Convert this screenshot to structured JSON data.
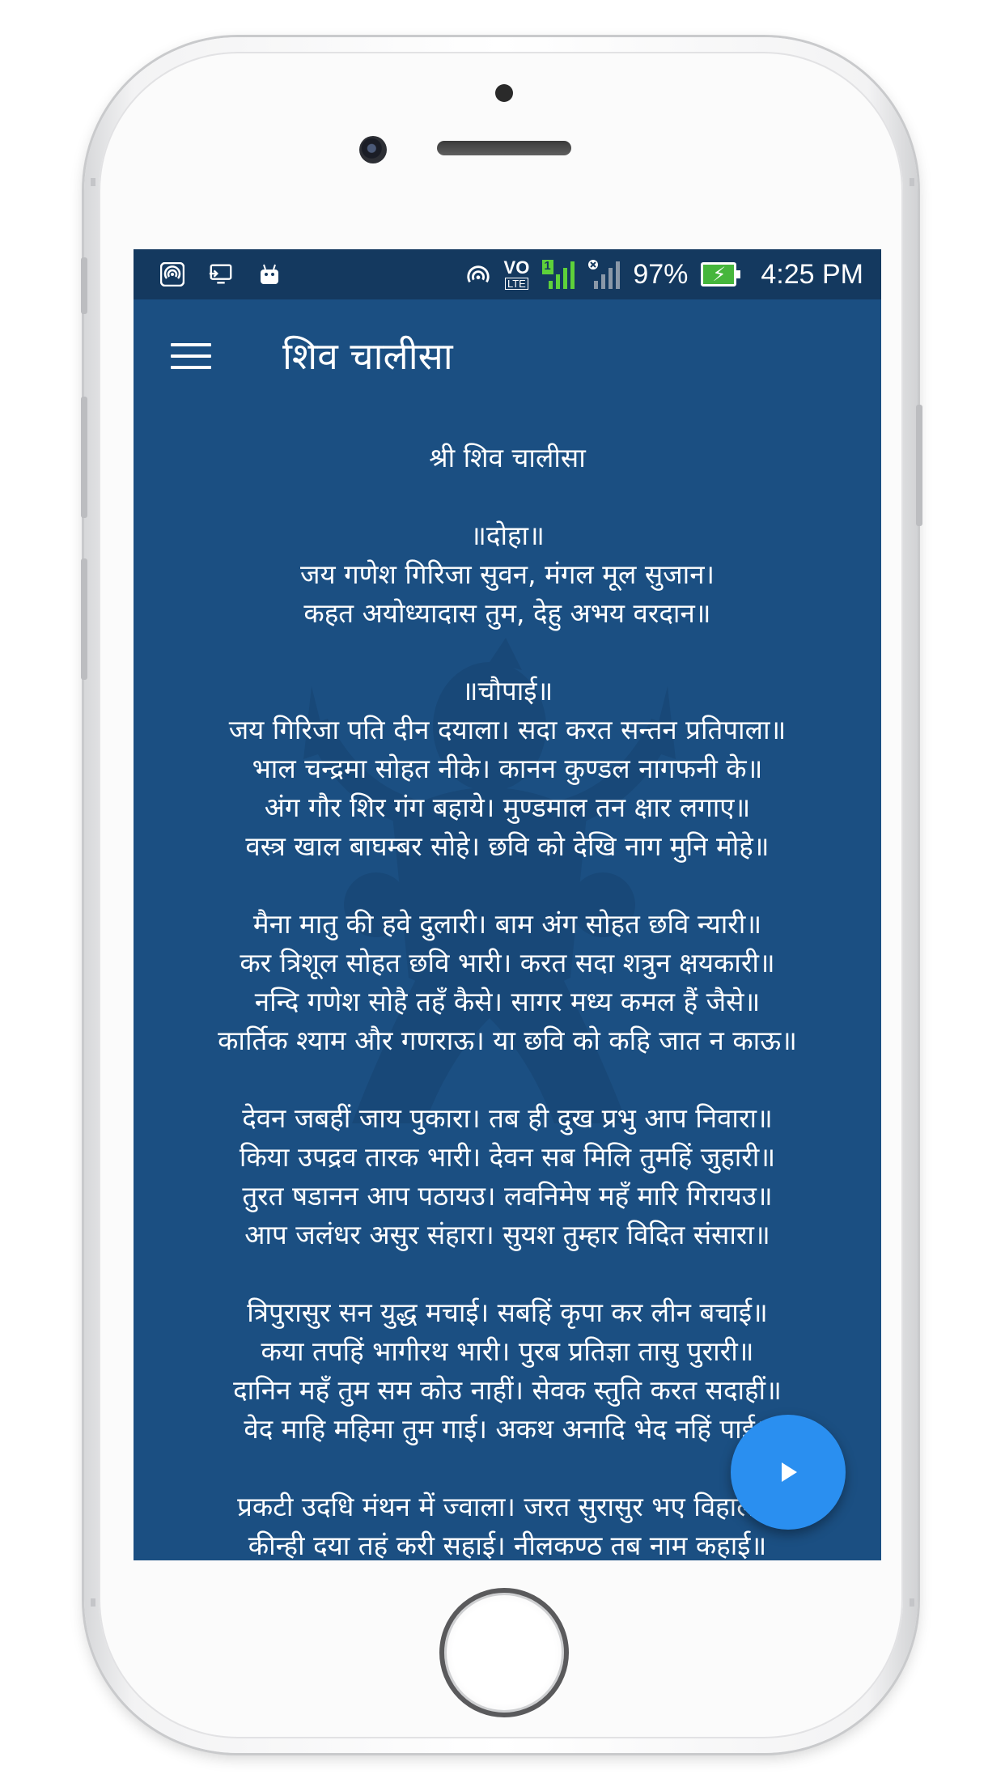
{
  "status_bar": {
    "battery_percent": "97%",
    "time": "4:25 PM",
    "volte_label": "VO",
    "lte_label": "LTE",
    "sim_slot": "1",
    "left_icons": [
      "hotspot-icon",
      "screen-cast-icon",
      "android-icon"
    ],
    "right_icons": [
      "hotspot-icon",
      "volte-icon",
      "signal-sim1-icon",
      "signal-sim2-no-service-icon",
      "battery-charging-icon"
    ]
  },
  "app_bar": {
    "title": "शिव चालीसा",
    "menu_icon": "hamburger-menu-icon"
  },
  "content": {
    "heading": "श्री शिव चालीसा",
    "stanzas": [
      [
        "॥दोहा॥",
        "जय गणेश गिरिजा सुवन, मंगल मूल सुजान।",
        "कहत अयोध्यादास तुम, देहु अभय वरदान॥"
      ],
      [
        "॥चौपाई॥",
        "जय गिरिजा पति दीन दयाला। सदा करत सन्तन प्रतिपाला॥",
        "भाल चन्द्रमा सोहत नीके। कानन कुण्डल नागफनी के॥",
        "अंग गौर शिर गंग बहाये। मुण्डमाल तन क्षार लगाए॥",
        "वस्त्र खाल बाघम्बर सोहे। छवि को देखि नाग मुनि मोहे॥"
      ],
      [
        "मैना मातु की हवे दुलारी। बाम अंग सोहत छवि न्यारी॥",
        "कर त्रिशूल सोहत छवि भारी। करत सदा शत्रुन क्षयकारी॥",
        "नन्दि गणेश सोहै तहँ कैसे। सागर मध्य कमल हैं जैसे॥",
        "कार्तिक श्याम और गणराऊ। या छवि को कहि जात न काऊ॥"
      ],
      [
        "देवन जबहीं जाय पुकारा। तब ही दुख प्रभु आप निवारा॥",
        "किया उपद्रव तारक भारी। देवन सब मिलि तुमहिं जुहारी॥",
        "तुरत षडानन आप पठायउ। लवनिमेष महँ मारि गिरायउ॥",
        "आप जलंधर असुर संहारा। सुयश तुम्हार विदित संसारा॥"
      ],
      [
        "त्रिपुरासुर सन युद्ध मचाई। सबहिं कृपा कर लीन बचाई॥",
        "कया तपहिं भागीरथ भारी। पुरब प्रतिज्ञा तासु पुरारी॥",
        "दानिन महँ तुम सम कोउ नाहीं। सेवक स्तुति करत सदाहीं॥",
        "वेद माहि महिमा तुम गाई। अकथ अनादि भेद नहिं पाई॥"
      ],
      [
        "प्रकटी उदधि मंथन में ज्वाला। जरत सुरासुर भए विहाला॥",
        "कीन्ही दया तहं करी सहाई। नीलकण्ठ तब नाम कहाई॥"
      ]
    ]
  },
  "fab": {
    "icon": "play-icon"
  },
  "colors": {
    "status_bar_bg": "#14395f",
    "screen_bg": "#1b4f82",
    "fab_bg": "#2a8ff0",
    "battery_fill": "#46b63c",
    "signal_active": "#5ed13a"
  }
}
